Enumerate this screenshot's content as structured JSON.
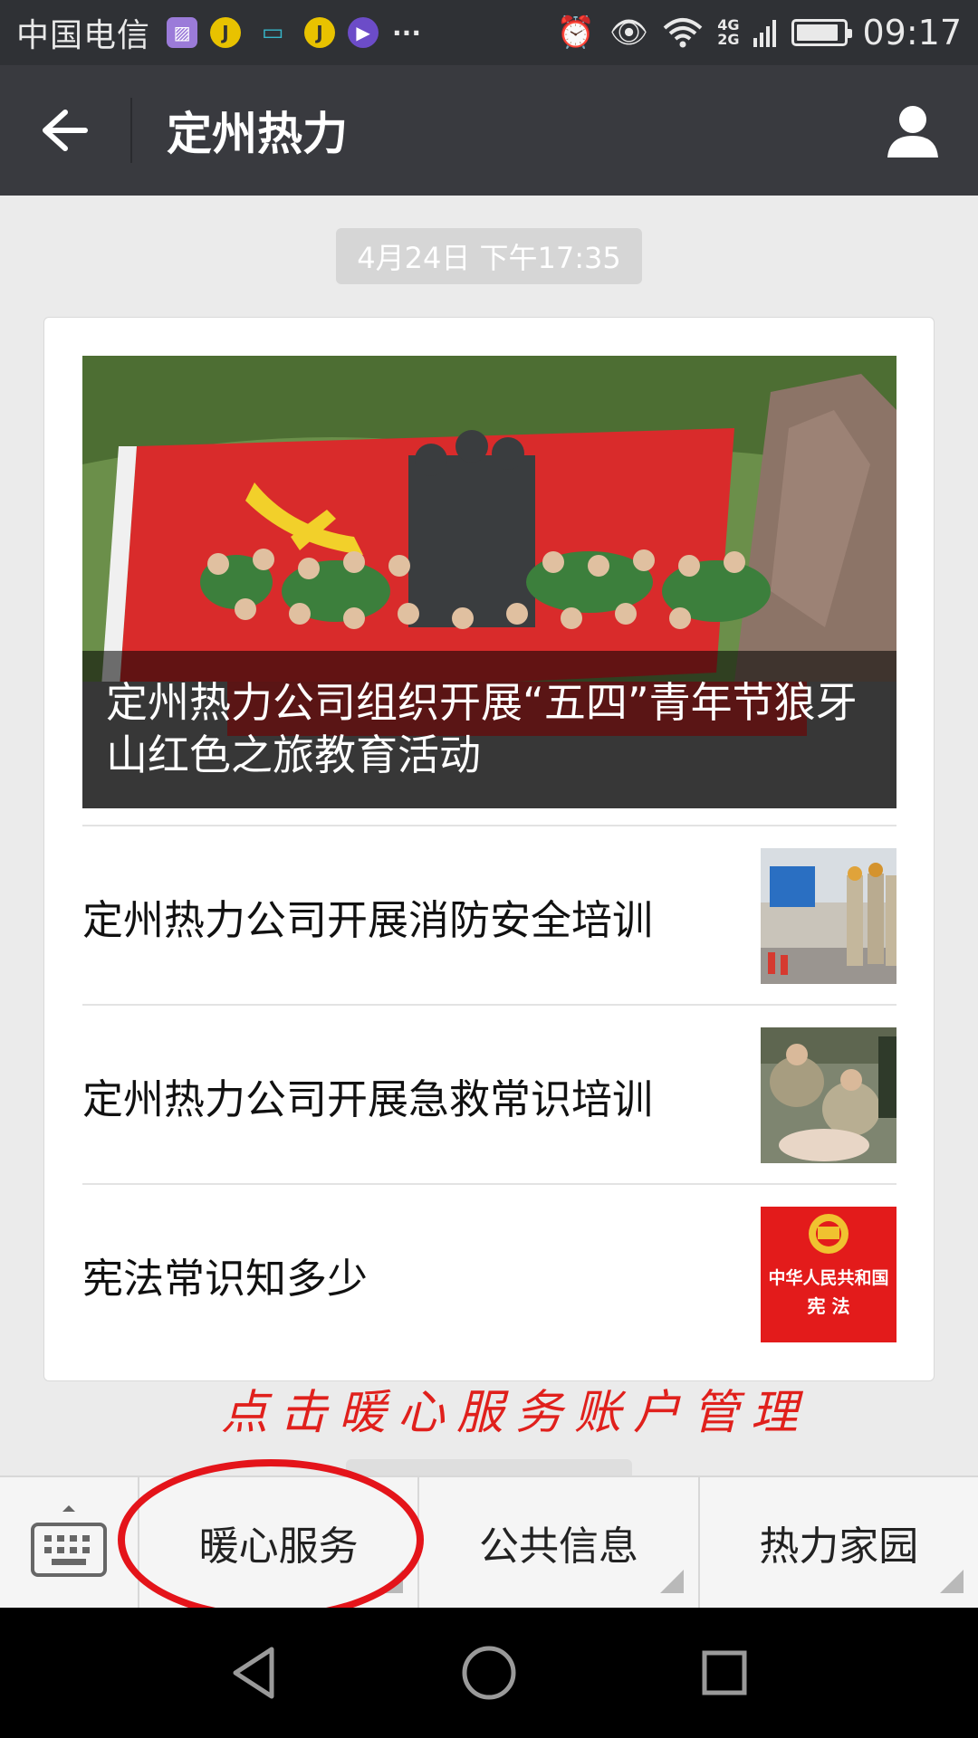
{
  "status_bar": {
    "carrier": "中国电信",
    "notification_icons": [
      "gallery-icon",
      "j-app-icon",
      "voicemail-icon",
      "j-app-icon",
      "video-icon"
    ],
    "more": "···",
    "network_top": "4G",
    "network_bottom": "2G",
    "battery_level": 0.9,
    "time": "09:17"
  },
  "header": {
    "title": "定州热力",
    "back_icon": "arrow-left-icon",
    "profile_icon": "person-icon"
  },
  "chat": {
    "timestamp": "4月24日 下午17:35",
    "hero_article": {
      "title": "定州热力公司组织开展“五四”青年节狼牙山红色之旅教育活动"
    },
    "articles": [
      {
        "title": "定州热力公司开展消防安全培训",
        "thumb": "fire-training-photo"
      },
      {
        "title": "定州热力公司开展急救常识培训",
        "thumb": "first-aid-photo"
      },
      {
        "title": "宪法常识知多少",
        "thumb": "constitution-cover",
        "thumb_text_1": "中华人民共和国",
        "thumb_text_2": "宪 法"
      }
    ]
  },
  "annotation": {
    "text": "点击暖心服务账户管理",
    "color": "#e0201c"
  },
  "menu": {
    "keyboard_icon": "keyboard-icon",
    "items": [
      {
        "label": "暖心服务"
      },
      {
        "label": "公共信息"
      },
      {
        "label": "热力家园"
      }
    ]
  },
  "nav": {
    "back": "triangle-back-icon",
    "home": "circle-home-icon",
    "recents": "square-recents-icon"
  }
}
